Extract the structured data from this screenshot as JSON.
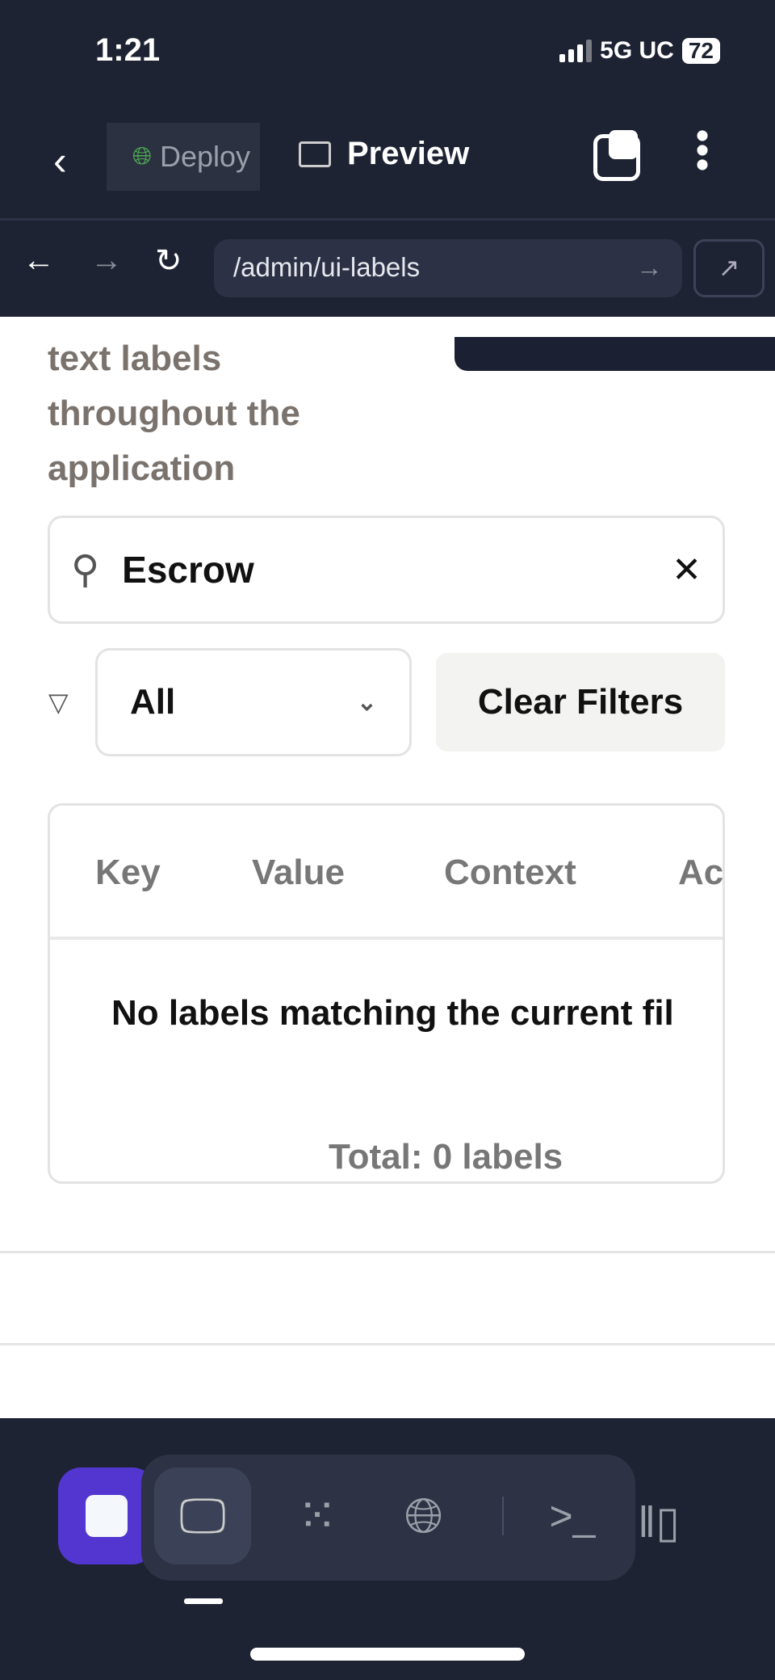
{
  "status_bar": {
    "time": "1:21",
    "network": "5G UC",
    "battery": "72"
  },
  "app_bar": {
    "deploy_label": "Deploy",
    "preview_label": "Preview"
  },
  "browser": {
    "url": "/admin/ui-labels"
  },
  "page": {
    "description": "text labels throughout the application",
    "search": {
      "value": "Escrow"
    },
    "filter": {
      "selected": "All"
    },
    "clear_filters_label": "Clear Filters",
    "table": {
      "columns": [
        "Key",
        "Value",
        "Context",
        "Ac"
      ],
      "empty_message": "No labels matching the current fil",
      "total": "Total: 0 labels"
    }
  },
  "colors": {
    "dark": "#1e2333",
    "accent": "#5236cf",
    "deploy_icon": "#4caf50"
  },
  "bottom_nav": {
    "icons": [
      "stop-icon",
      "monitor-icon",
      "dots-grid-icon",
      "deploy-globe-icon",
      "terminal-icon",
      "devices-icon"
    ]
  }
}
